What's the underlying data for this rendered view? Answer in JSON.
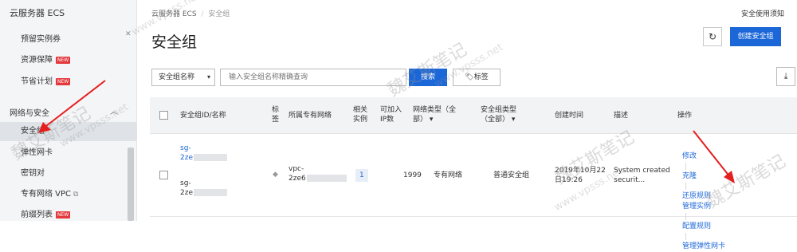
{
  "sidebar": {
    "title": "云服务器 ECS",
    "items_top": [
      {
        "label": "预留实例券",
        "new": false
      },
      {
        "label": "资源保障",
        "new": true
      },
      {
        "label": "节省计划",
        "new": true
      }
    ],
    "group": "网络与安全",
    "items_net": [
      {
        "label": "安全组",
        "new": false
      },
      {
        "label": "弹性网卡",
        "new": false
      },
      {
        "label": "密钥对",
        "new": false
      },
      {
        "label": "专有网络 VPC",
        "new": false
      },
      {
        "label": "前缀列表",
        "new": true
      }
    ],
    "new_text": "NEW"
  },
  "breadcrumb": {
    "root": "云服务器 ECS",
    "sep": "/",
    "current": "安全组"
  },
  "notice": "安全使用须知",
  "page_title": "安全组",
  "create_button": "创建安全组",
  "filter": {
    "select": "安全组名称",
    "placeholder": "输入安全组名称精确查询",
    "search_button": "搜索",
    "tag_button": "标签"
  },
  "table": {
    "headers": {
      "id_name": "安全组ID/名称",
      "tag": "标签",
      "vpc": "所属专有网络",
      "related_1": "相关",
      "related_2": "实例",
      "avail_1": "可加入",
      "avail_2": "IP数",
      "net_type_1": "网络类型（全",
      "net_type_2": "部）",
      "sg_type_1": "安全组类型",
      "sg_type_2": "（全部）",
      "created": "创建时间",
      "desc": "描述",
      "ops": "操作"
    },
    "row": {
      "id_prefix": "sg-",
      "id_second": "2ze",
      "name_prefix": "sg-",
      "name_second": "2ze",
      "vpc_prefix": "vpc-",
      "vpc_second": "2ze6",
      "related": "1",
      "avail": "1999",
      "net_type": "专有网络",
      "sg_type": "普通安全组",
      "created_1": "2019年10月22",
      "created_2": "日19:26",
      "desc_1": "System created",
      "desc_2": "securit...",
      "ops": {
        "modify": "修改",
        "clone": "克隆",
        "restore": "还原规则",
        "manage_instances": "管理实例",
        "config_rules": "配置规则",
        "manage_eni": "管理弹性网卡"
      }
    }
  },
  "watermark": {
    "text": "魏艾斯笔记",
    "url": "www.vpsss.net"
  }
}
